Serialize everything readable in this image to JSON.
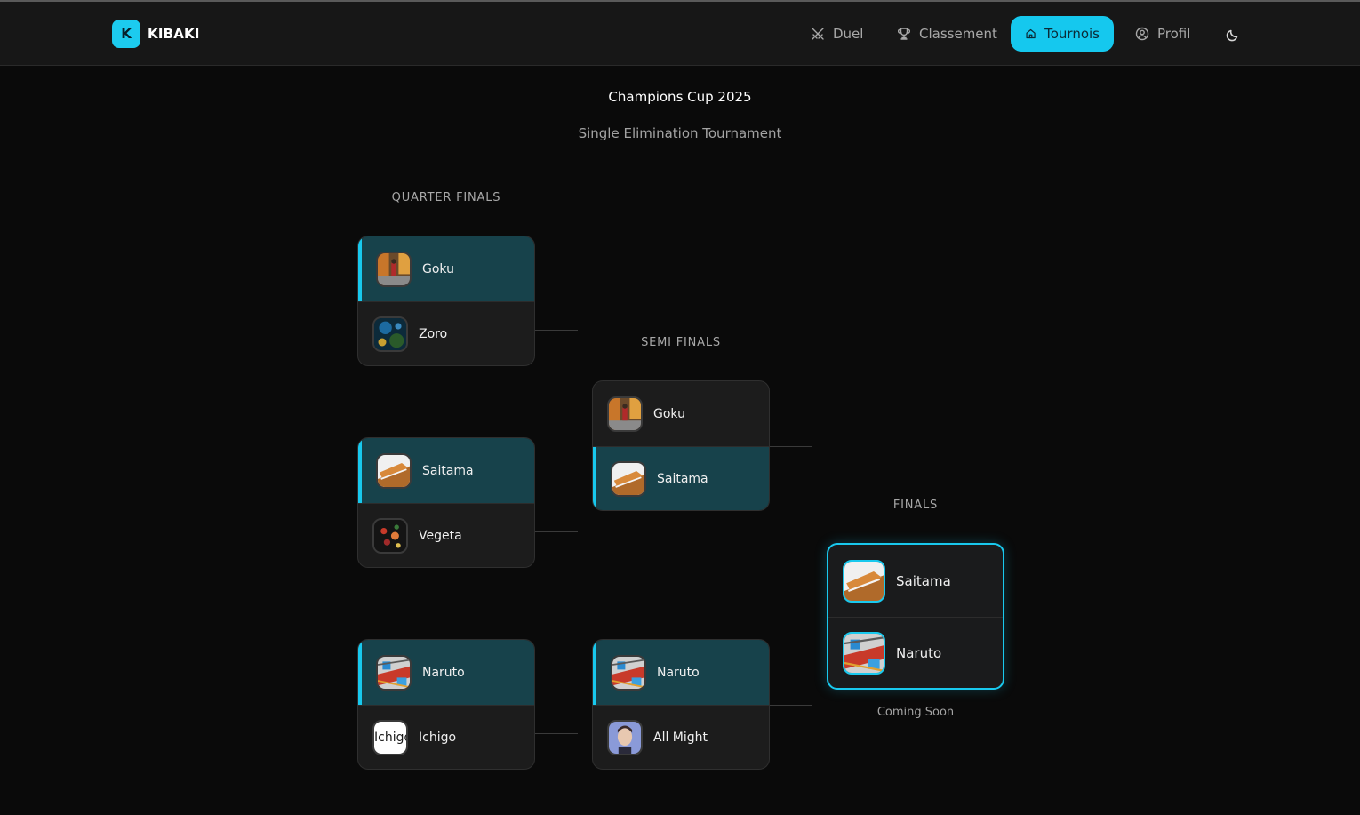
{
  "brand": {
    "badge": "K",
    "name": "KIBAKI"
  },
  "nav": [
    {
      "label": "Duel",
      "icon": "swords-icon",
      "active": false
    },
    {
      "label": "Classement",
      "icon": "trophy-icon",
      "active": false
    },
    {
      "label": "Tournois",
      "icon": "home-icon",
      "active": true
    },
    {
      "label": "Profil",
      "icon": "user-circle-icon",
      "active": false
    }
  ],
  "theme_toggle_icon": "moon-icon",
  "tournament": {
    "title": "Champions Cup 2025",
    "subtitle": "Single Elimination Tournament"
  },
  "rounds": {
    "quarter": "QUARTER FINALS",
    "semi": "SEMI FINALS",
    "final": "FINALS"
  },
  "quarter_matches": [
    {
      "p1": "Goku",
      "p2": "Zoro",
      "winner": 1
    },
    {
      "p1": "Saitama",
      "p2": "Vegeta",
      "winner": 1
    },
    {
      "p1": "Naruto",
      "p2": "Ichigo",
      "winner": 1
    }
  ],
  "semi_matches": [
    {
      "p1": "Goku",
      "p2": "Saitama",
      "winner": 2
    },
    {
      "p1": "Naruto",
      "p2": "All Might",
      "winner": 1
    }
  ],
  "final_match": {
    "p1": "Saitama",
    "p2": "Naruto"
  },
  "final_status": "Coming Soon",
  "broken_image_alt": "Ichigo",
  "colors": {
    "accent": "#15c8ee",
    "winner_bg": "#17424b",
    "card_bg": "#1c1c1c",
    "page_bg": "#0a0a0a"
  }
}
